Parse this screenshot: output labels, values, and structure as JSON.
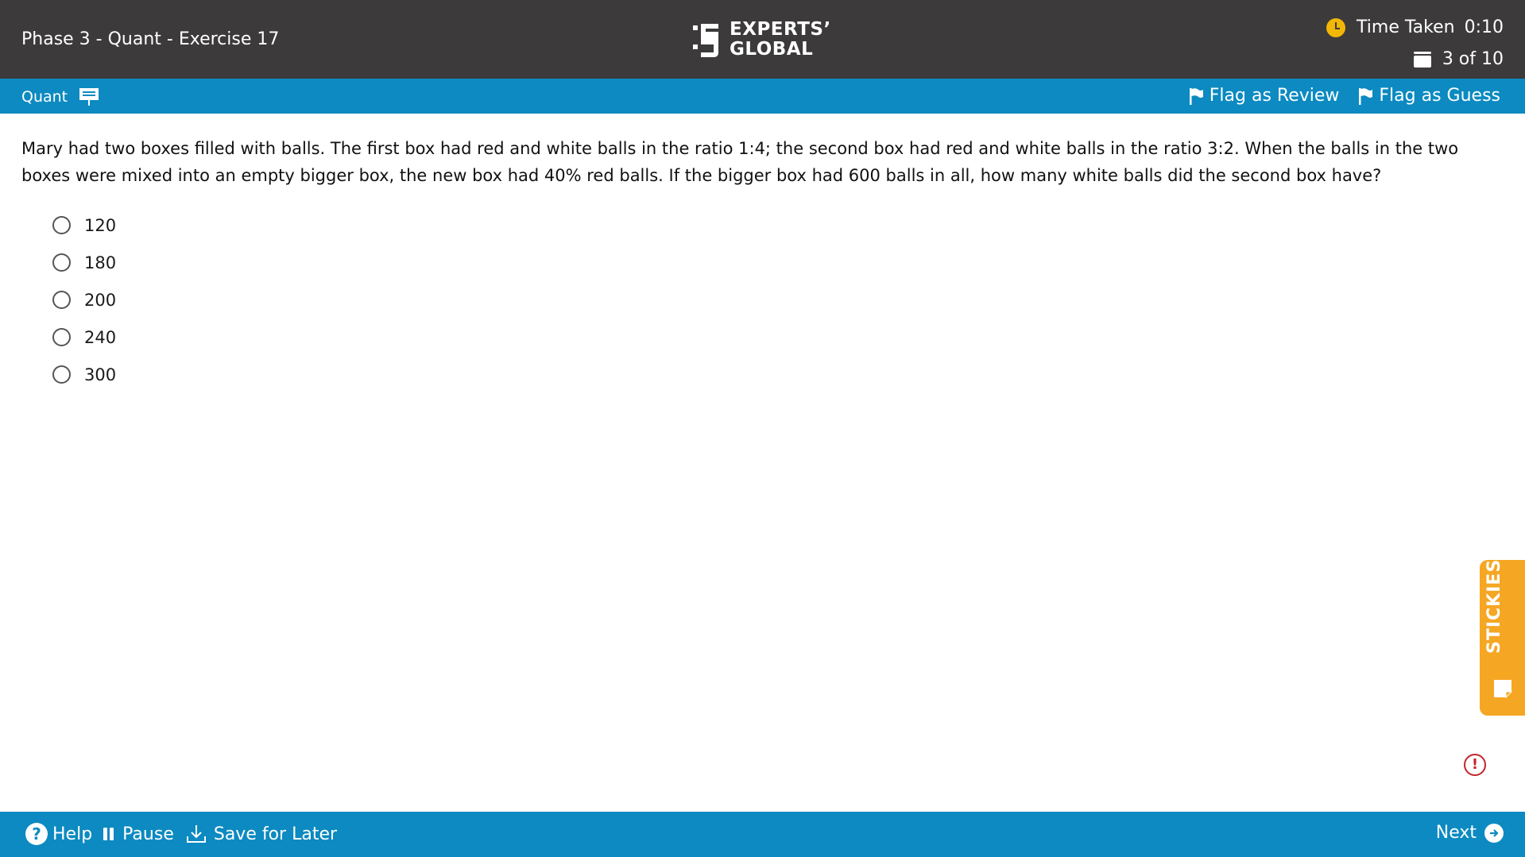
{
  "header": {
    "exercise_title": "Phase 3 - Quant - Exercise 17",
    "logo_line1": "EXPERTS’",
    "logo_line2": "GLOBAL",
    "time_label": "Time Taken",
    "time_value": "0:10",
    "question_counter": "3 of 10"
  },
  "section_bar": {
    "section_name": "Quant",
    "flag_review_label": "Flag as Review",
    "flag_guess_label": "Flag as Guess"
  },
  "question": {
    "text": "Mary had two boxes filled with balls. The first box had red and white balls in the ratio 1:4; the second box had red and white balls in the ratio 3:2. When the balls in the two boxes were mixed into an empty bigger box, the new box had 40% red balls. If the bigger box had 600 balls in all, how many white balls did the second box have?",
    "options": [
      "120",
      "180",
      "200",
      "240",
      "300"
    ]
  },
  "stickies_label": "STICKIES",
  "footer": {
    "help_label": "Help",
    "pause_label": "Pause",
    "save_label": "Save for Later",
    "next_label": "Next"
  },
  "colors": {
    "header_bg": "#3c3a3b",
    "accent_blue": "#0c8ac1",
    "stickies_orange": "#f5a623",
    "clock_yellow": "#f2b705",
    "alert_red": "#c0262d"
  },
  "icons": [
    "clock-icon",
    "question-stack-icon",
    "whiteboard-icon",
    "flag-icon",
    "sticky-note-icon",
    "alert-icon",
    "help-icon",
    "pause-icon",
    "download-icon",
    "arrow-right-icon"
  ]
}
